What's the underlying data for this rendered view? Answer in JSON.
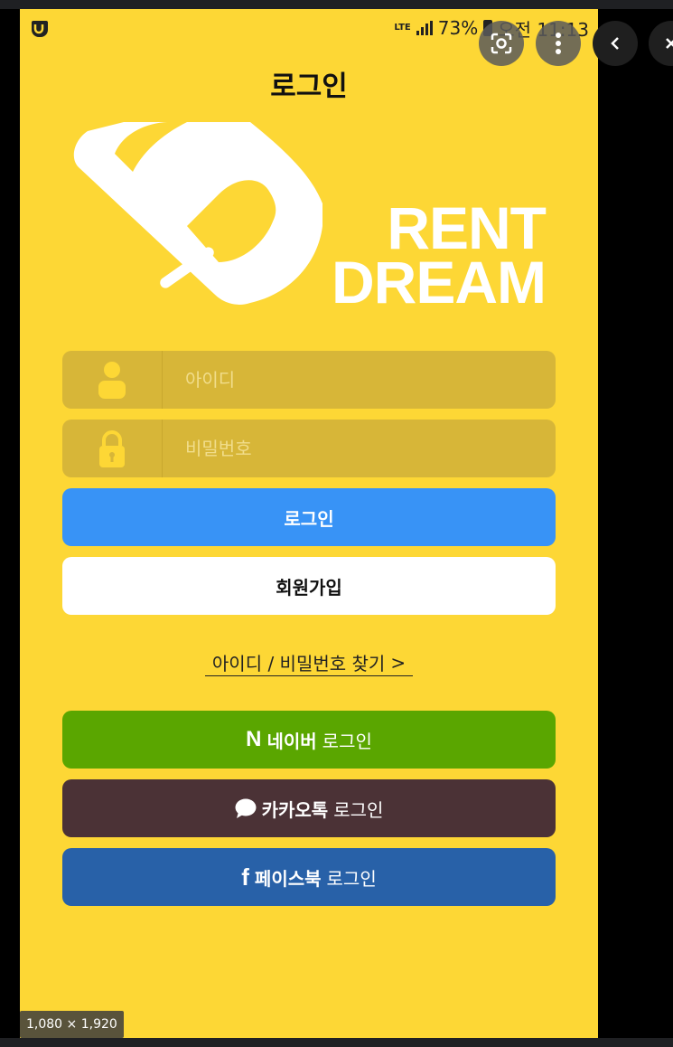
{
  "status_bar": {
    "network": "LTE",
    "battery": "73%",
    "time": "오전 11:13"
  },
  "header": {
    "title": "로그인"
  },
  "logo": {
    "line1": "RENT",
    "line2": "DREAM"
  },
  "form": {
    "id_placeholder": "아이디",
    "password_placeholder": "비밀번호",
    "login_label": "로그인",
    "signup_label": "회원가입",
    "find_link": "아이디 / 비밀번호 찾기",
    "find_link_arrow": ">"
  },
  "social": [
    {
      "brand": "네이버",
      "suffix": "로그인",
      "icon": "N",
      "color": "#5aa600"
    },
    {
      "brand": "카카오톡",
      "suffix": "로그인",
      "icon": "speech-bubble-icon",
      "color": "#4b3236"
    },
    {
      "brand": "페이스북",
      "suffix": "로그인",
      "icon": "f",
      "color": "#2861a8"
    }
  ],
  "viewer": {
    "dimensions": "1,080 × 1,920"
  },
  "colors": {
    "background": "#fdd735",
    "field": "#d7b638",
    "login_button": "#3893f6"
  }
}
